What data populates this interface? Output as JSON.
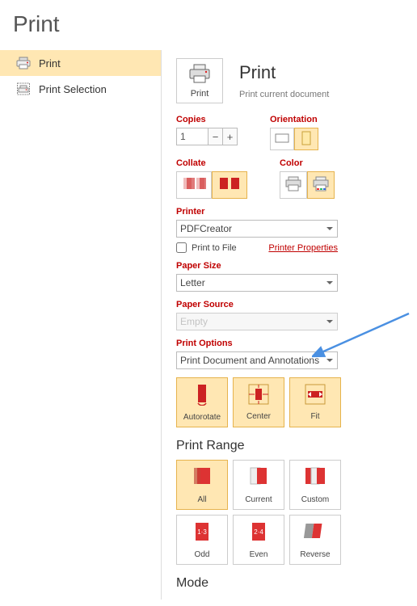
{
  "page": {
    "title": "Print"
  },
  "sidebar": {
    "items": [
      {
        "label": "Print"
      },
      {
        "label": "Print Selection"
      }
    ]
  },
  "header": {
    "btnLabel": "Print",
    "heading": "Print",
    "sub": "Print current document"
  },
  "copies": {
    "label": "Copies",
    "value": "1"
  },
  "orientation": {
    "label": "Orientation"
  },
  "collate": {
    "label": "Collate"
  },
  "color": {
    "label": "Color"
  },
  "printer": {
    "label": "Printer",
    "value": "PDFCreator",
    "toFile": "Print to File",
    "props": "Printer Properties"
  },
  "paperSize": {
    "label": "Paper Size",
    "value": "Letter"
  },
  "paperSource": {
    "label": "Paper Source",
    "value": "Empty"
  },
  "printOptions": {
    "label": "Print Options",
    "value": "Print Document and Annotations"
  },
  "tiles": {
    "auto": "Autorotate",
    "center": "Center",
    "fit": "Fit"
  },
  "range": {
    "heading": "Print Range",
    "all": "All",
    "current": "Current",
    "custom": "Custom",
    "odd": "Odd",
    "even": "Even",
    "reverse": "Reverse"
  },
  "mode": {
    "heading": "Mode"
  }
}
